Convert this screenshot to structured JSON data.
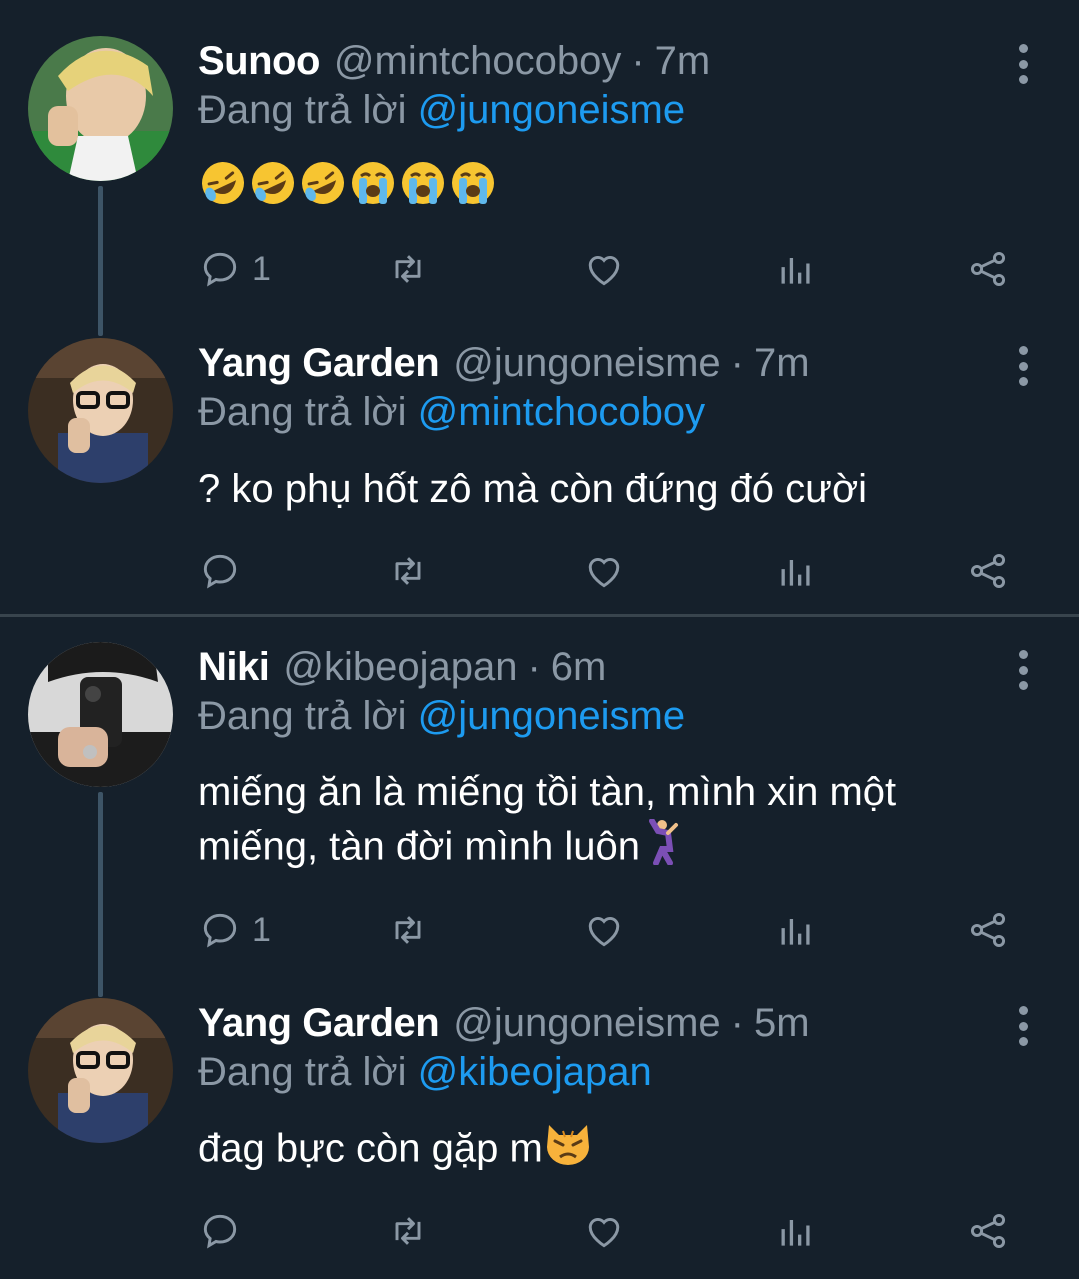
{
  "reply_prefix": "Đang trả lời",
  "tweets": [
    {
      "name": "Sunoo",
      "handle": "@mintchocoboy",
      "dot": "·",
      "time": "7m",
      "reply_to": "@jungoneisme",
      "text": "",
      "emoji": [
        "rolling-on-floor-laughing",
        "rolling-on-floor-laughing",
        "rolling-on-floor-laughing",
        "loudly-crying",
        "loudly-crying",
        "loudly-crying"
      ],
      "reply_count": "1"
    },
    {
      "name": "Yang Garden",
      "handle": "@jungoneisme",
      "dot": "·",
      "time": "7m",
      "reply_to": "@mintchocoboy",
      "text": "? ko phụ hốt zô mà còn đứng đó cười",
      "reply_count": ""
    },
    {
      "name": "Niki",
      "handle": "@kibeojapan",
      "dot": "·",
      "time": "6m",
      "reply_to": "@jungoneisme",
      "text": "miếng ăn là miếng tồi tàn, mình xin một miếng, tàn đời mình luôn",
      "emoji": [
        "man-dancing"
      ],
      "reply_count": "1"
    },
    {
      "name": "Yang Garden",
      "handle": "@jungoneisme",
      "dot": "·",
      "time": "5m",
      "reply_to": "@kibeojapan",
      "text": "đag bực còn gặp m",
      "emoji": [
        "pouting-cat"
      ],
      "reply_count": ""
    }
  ],
  "colors": {
    "background": "#15202b",
    "secondary_text": "#8b98a5",
    "link": "#1d9bf0",
    "divider": "#38444d"
  }
}
